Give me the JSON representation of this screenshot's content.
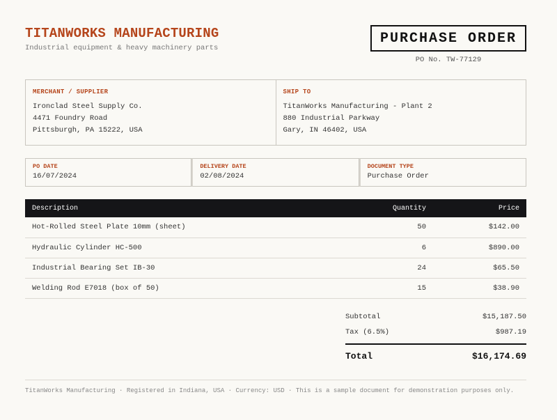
{
  "company": {
    "name": "TITANWORKS MANUFACTURING",
    "tagline": "Industrial equipment & heavy machinery parts"
  },
  "document": {
    "title": "PURCHASE ORDER",
    "po_number": "PO No. TW-77129"
  },
  "merchant": {
    "label": "MERCHANT / SUPPLIER",
    "lines": [
      "Ironclad Steel Supply Co.",
      "4471 Foundry Road",
      "Pittsburgh, PA 15222, USA"
    ]
  },
  "ship_to": {
    "label": "SHIP TO",
    "lines": [
      "TitanWorks Manufacturing - Plant 2",
      "880 Industrial Parkway",
      "Gary, IN 46402, USA"
    ]
  },
  "meta": [
    {
      "label": "PO DATE",
      "value": "16/07/2024"
    },
    {
      "label": "DELIVERY DATE",
      "value": "02/08/2024"
    },
    {
      "label": "DOCUMENT TYPE",
      "value": "Purchase Order"
    }
  ],
  "table": {
    "headers": {
      "description": "Description",
      "quantity": "Quantity",
      "price": "Price"
    },
    "rows": [
      {
        "description": "Hot-Rolled Steel Plate 10mm (sheet)",
        "quantity": "50",
        "price": "$142.00"
      },
      {
        "description": "Hydraulic Cylinder HC-500",
        "quantity": "6",
        "price": "$890.00"
      },
      {
        "description": "Industrial Bearing Set IB-30",
        "quantity": "24",
        "price": "$65.50"
      },
      {
        "description": "Welding Rod E7018 (box of 50)",
        "quantity": "15",
        "price": "$38.90"
      }
    ]
  },
  "totals": {
    "subtotal_label": "Subtotal",
    "subtotal": "$15,187.50",
    "tax_label": "Tax (6.5%)",
    "tax": "$987.19",
    "total_label": "Total",
    "total": "$16,174.69"
  },
  "footer": "TitanWorks Manufacturing · Registered in Indiana, USA · Currency: USD · This is a sample document for demonstration purposes only.",
  "colors": {
    "accent": "#b5451b",
    "header_bg": "#151518",
    "background": "#faf9f5"
  }
}
